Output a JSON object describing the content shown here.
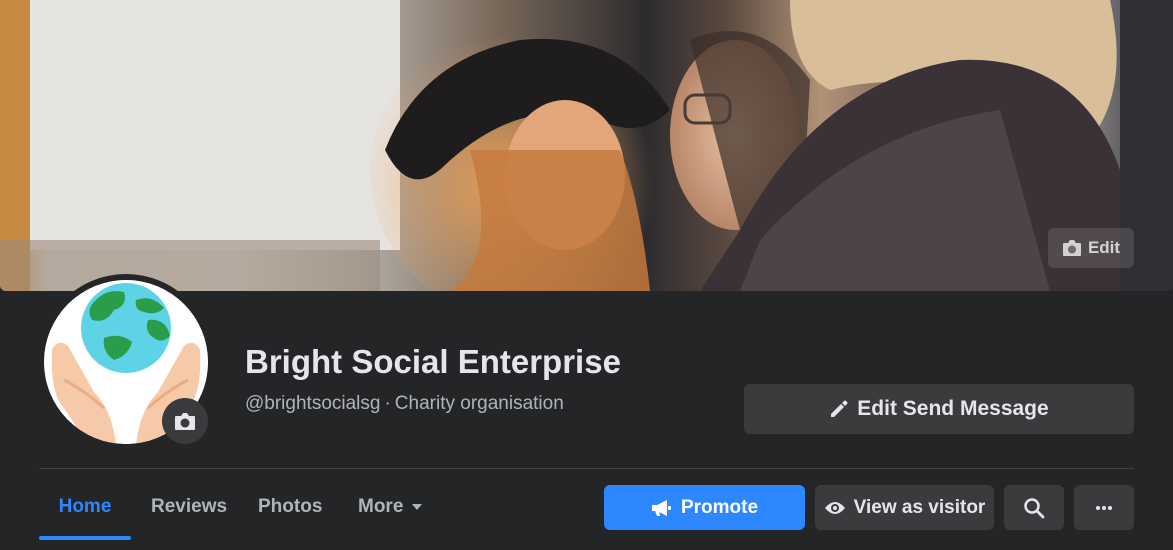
{
  "cover": {
    "edit_label": "Edit",
    "edit_icon": "camera-icon"
  },
  "profile": {
    "name": "Bright Social Enterprise",
    "handle": "@brightsocialsg",
    "separator": "·",
    "category": "Charity organisation",
    "avatar_icon": "globe-in-hands-icon"
  },
  "actions": {
    "edit_send_message": "Edit Send Message",
    "promote": "Promote",
    "view_as_visitor": "View as visitor"
  },
  "tabs": [
    {
      "label": "Home",
      "active": true
    },
    {
      "label": "Reviews",
      "active": false
    },
    {
      "label": "Photos",
      "active": false
    },
    {
      "label": "More",
      "active": false
    }
  ],
  "colors": {
    "background": "#242526",
    "accent": "#2d88ff",
    "button": "#3a3b3c",
    "text_primary": "#e4e6eb",
    "text_secondary": "#b0b3b8"
  }
}
